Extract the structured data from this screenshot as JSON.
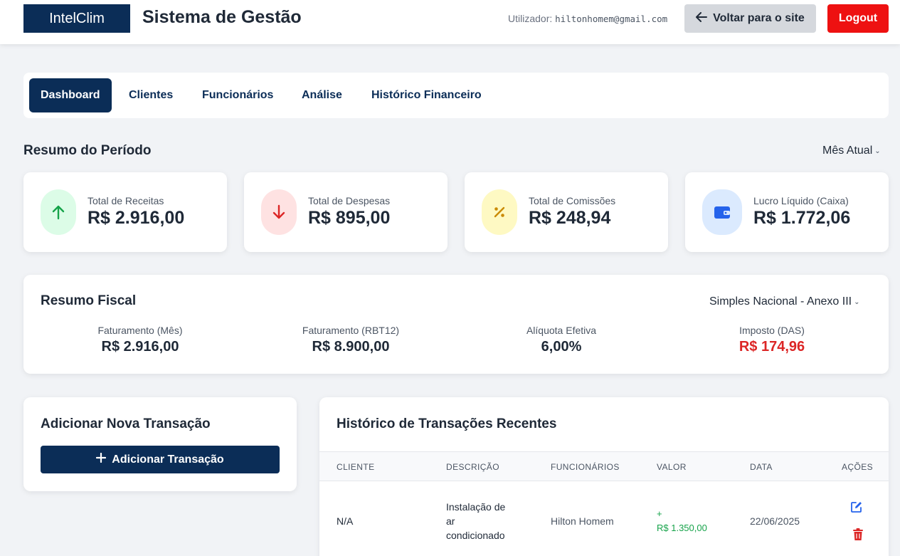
{
  "header": {
    "logo": "IntelClim",
    "title": "Sistema de Gestão",
    "user_label": "Utilizador:",
    "user_email": "hiltonhomem@gmail.com",
    "back_label": "Voltar para o site",
    "logout_label": "Logout"
  },
  "tabs": [
    {
      "label": "Dashboard",
      "active": true
    },
    {
      "label": "Clientes"
    },
    {
      "label": "Funcionários"
    },
    {
      "label": "Análise"
    },
    {
      "label": "Histórico Financeiro"
    }
  ],
  "summary": {
    "title": "Resumo do Período",
    "period_select": "Mês Atual",
    "cards": [
      {
        "label": "Total de Receitas",
        "value": "R$ 2.916,00",
        "icon": "arrow-up-icon",
        "color": "#16a34a",
        "bg": "#dcfce7"
      },
      {
        "label": "Total de Despesas",
        "value": "R$ 895,00",
        "icon": "arrow-down-icon",
        "color": "#dc2626",
        "bg": "#fee2e2"
      },
      {
        "label": "Total de Comissões",
        "value": "R$ 248,94",
        "icon": "percent-icon",
        "color": "#ca8a04",
        "bg": "#fef9c3"
      },
      {
        "label": "Lucro Líquido (Caixa)",
        "value": "R$ 1.772,06",
        "icon": "wallet-icon",
        "color": "#2563eb",
        "bg": "#dbeafe"
      }
    ]
  },
  "fiscal": {
    "title": "Resumo Fiscal",
    "regime_select": "Simples Nacional - Anexo III",
    "items": [
      {
        "label": "Faturamento (Mês)",
        "value": "R$ 2.916,00"
      },
      {
        "label": "Faturamento (RBT12)",
        "value": "R$ 8.900,00"
      },
      {
        "label": "Alíquota Efetiva",
        "value": "6,00%"
      },
      {
        "label": "Imposto (DAS)",
        "value": "R$ 174,96",
        "color": "#dc2626"
      }
    ]
  },
  "add_transaction": {
    "title": "Adicionar Nova Transação",
    "button_label": "Adicionar Transação"
  },
  "history": {
    "title": "Histórico de Transações Recentes",
    "columns": [
      "CLIENTE",
      "DESCRIÇÃO",
      "FUNCIONÁRIOS",
      "VALOR",
      "DATA",
      "AÇÕES"
    ],
    "rows": [
      {
        "cliente": "N/A",
        "descricao_lines": [
          "Instalação de",
          "ar",
          "condicionado"
        ],
        "funcionarios": "Hilton Homem",
        "valor_sign": "+",
        "valor": "R$ 1.350,00",
        "data": "22/06/2025"
      }
    ]
  }
}
